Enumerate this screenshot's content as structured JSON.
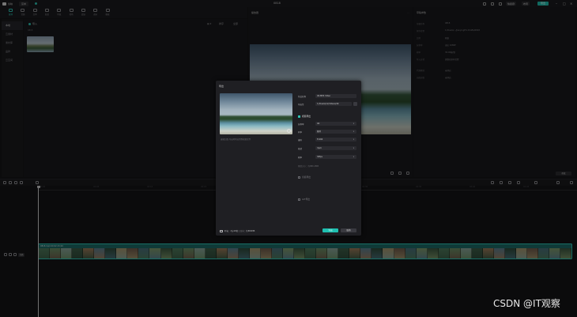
{
  "titlebar": {
    "app_name": "剪映",
    "menu_label": "菜单",
    "project_title": "0818",
    "shortcut_label": "快捷键",
    "layout_label": "布局",
    "export_label": "导出"
  },
  "tooltabs": [
    {
      "label": "媒体",
      "active": true
    },
    {
      "label": "音频"
    },
    {
      "label": "文本"
    },
    {
      "label": "贴纸"
    },
    {
      "label": "特效"
    },
    {
      "label": "转场"
    },
    {
      "label": "滤镜"
    },
    {
      "label": "调节"
    },
    {
      "label": "模板"
    }
  ],
  "media_nav": {
    "items": [
      {
        "label": "本地",
        "active": true
      },
      {
        "label": "云素材"
      },
      {
        "label": "素材库"
      },
      {
        "label": "品牌"
      },
      {
        "label": "云空间"
      }
    ]
  },
  "media": {
    "header": "导入",
    "sub": "0818",
    "sort_label": "排序",
    "filter_label": "全部"
  },
  "player": {
    "title": "播放器",
    "menu": "···"
  },
  "props": {
    "title": "草稿参数",
    "rows": [
      {
        "label": "草稿名称",
        "value": "0818"
      },
      {
        "label": "保存位置",
        "value": "C:/Users/.../JianyingPro Drafts/0818"
      },
      {
        "label": "比例",
        "value": "原始"
      },
      {
        "label": "分辨率",
        "value": "适应 1080P"
      },
      {
        "label": "帧率",
        "value": "30.00帧/秒"
      },
      {
        "label": "导入方式",
        "value": "保留在原有位置"
      },
      {
        "label": "代理模式",
        "value": "未开启"
      },
      {
        "label": "自由层级",
        "value": "未开启"
      }
    ],
    "modify_label": "修改"
  },
  "timeline": {
    "ruler_labels": [
      "00:00",
      "00:05",
      "00:10",
      "00:15",
      "00:20",
      "00:25",
      "00:30",
      "00:35",
      "00:40",
      "00:45"
    ],
    "cover_label": "封面",
    "clip_name": "0818.mp4  00:02:15:20"
  },
  "dialog": {
    "title": "导出",
    "cover_note": "编辑封面  导出时将应用到视频文件",
    "fields": {
      "name_label": "作品名称",
      "name_value": "4K.MP4 Video",
      "path_label": "导出至",
      "path_value": "C:/Users/xx/Videos/4K",
      "resolution_label": "分辨率",
      "resolution_value": "4K",
      "bitrate_label": "码率",
      "bitrate_value": "推荐",
      "codec_label": "编码",
      "codec_value": "H.264",
      "format_label": "格式",
      "format_value": "mp4",
      "fps_label": "帧率",
      "fps_value": "30fps"
    },
    "video_section": "视频导出",
    "audio_section": "音频导出",
    "gif_section": "GIF导出",
    "estimate": "预估大小：约880.2MB",
    "footer": "时长：2分18秒 | 大小：约880MB",
    "export_button": "导出",
    "cancel_button": "取消"
  },
  "watermark": "CSDN @IT观察"
}
